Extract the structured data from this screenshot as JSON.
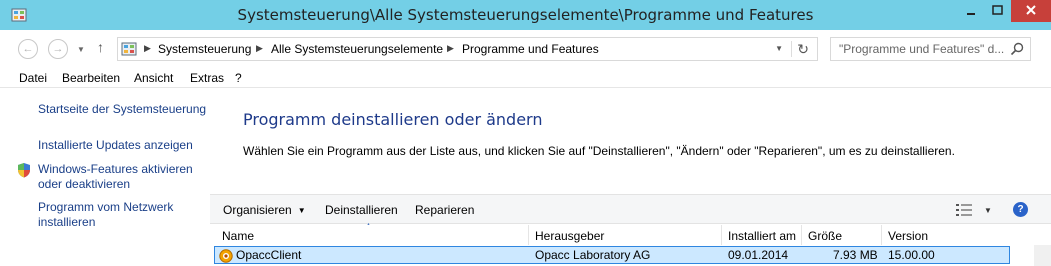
{
  "window": {
    "title": "Systemsteuerung\\Alle Systemsteuerungselemente\\Programme und Features"
  },
  "navigation": {
    "back_icon": "left-arrow",
    "forward_icon": "right-arrow",
    "up_icon": "up-arrow",
    "breadcrumb": [
      "Systemsteuerung",
      "Alle Systemsteuerungselemente",
      "Programme und Features"
    ],
    "search_placeholder": "\"Programme und Features\" d..."
  },
  "menu": {
    "items": [
      "Datei",
      "Bearbeiten",
      "Ansicht",
      "Extras",
      "?"
    ]
  },
  "sidebar": {
    "links": [
      {
        "label": "Startseite der Systemsteuerung"
      },
      {
        "label": "Installierte Updates anzeigen"
      },
      {
        "label_line1": "Windows-Features aktivieren",
        "label_line2": "oder deaktivieren",
        "icon": "shield-icon"
      },
      {
        "label_line1": "Programm vom Netzwerk",
        "label_line2": "installieren"
      }
    ]
  },
  "main": {
    "heading": "Programm deinstallieren oder ändern",
    "instructions": "Wählen Sie ein Programm aus der Liste aus, und klicken Sie auf \"Deinstallieren\", \"Ändern\" oder \"Reparieren\", um es zu deinstallieren.",
    "toolbar": {
      "organize": "Organisieren",
      "uninstall": "Deinstallieren",
      "repair": "Reparieren",
      "help": "?"
    },
    "columns": [
      "Name",
      "Herausgeber",
      "Installiert am",
      "Größe",
      "Version"
    ],
    "rows": [
      {
        "name": "OpaccClient",
        "publisher": "Opacc Laboratory AG",
        "installed": "09.01.2014",
        "size": "7.93 MB",
        "version": "15.00.00"
      }
    ]
  },
  "colors": {
    "titlebar": "#73cfe6",
    "close_button": "#c7403a",
    "link": "#1a3f88",
    "heading": "#1e3a8a",
    "selection": "#cce8ff",
    "selection_border": "#2f86e0"
  }
}
